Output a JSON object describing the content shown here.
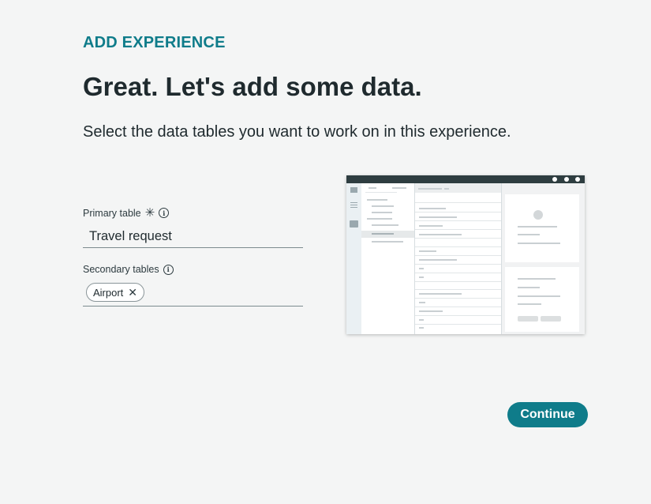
{
  "header": {
    "eyebrow": "ADD EXPERIENCE",
    "title": "Great. Let's add some data.",
    "subtitle": "Select the data tables you want to work on in this experience."
  },
  "form": {
    "primary_label": "Primary table",
    "primary_value": "Travel request",
    "secondary_label": "Secondary tables",
    "secondary_chips": [
      "Airport"
    ]
  },
  "actions": {
    "continue_label": "Continue"
  },
  "colors": {
    "accent": "#0f7c8a",
    "background": "#f4f5f5",
    "text": "#1f2a2e"
  },
  "icons": {
    "required": "asterisk-icon",
    "info": "info-icon",
    "chip_remove": "close-icon"
  }
}
